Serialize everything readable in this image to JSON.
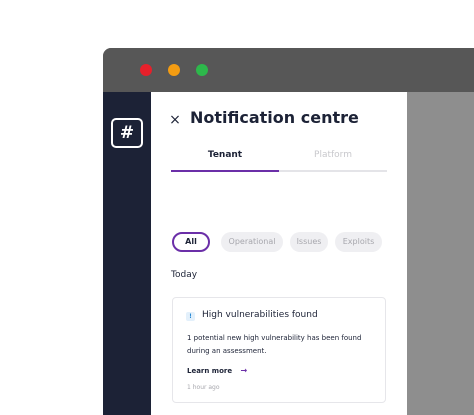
{
  "window": {
    "controls": [
      "close",
      "minimize",
      "maximize"
    ]
  },
  "sidebar": {
    "logo_glyph": "#"
  },
  "panel": {
    "close_icon": "×",
    "title": "Notification centre",
    "tabs": [
      {
        "label": "Tenant",
        "active": true
      },
      {
        "label": "Platform",
        "active": false
      }
    ],
    "filters": [
      {
        "label": "All",
        "selected": true
      },
      {
        "label": "Operational",
        "selected": false
      },
      {
        "label": "Issues",
        "selected": false
      },
      {
        "label": "Exploits",
        "selected": false
      }
    ],
    "section_label": "Today",
    "notification": {
      "icon_glyph": "!",
      "title": "High vulnerabilities found",
      "body": "1 potential new high vulnerability has been found during an assessment.",
      "link_label": "Learn more",
      "link_arrow": "→",
      "timestamp": "1 hour ago"
    }
  },
  "colors": {
    "accent": "#6b2fa8",
    "sidebar": "#1c2236",
    "titlebar": "#575757",
    "close": "#e6202b",
    "minimize": "#f39c12",
    "maximize": "#2db84b",
    "info": "#2a8ad4"
  }
}
